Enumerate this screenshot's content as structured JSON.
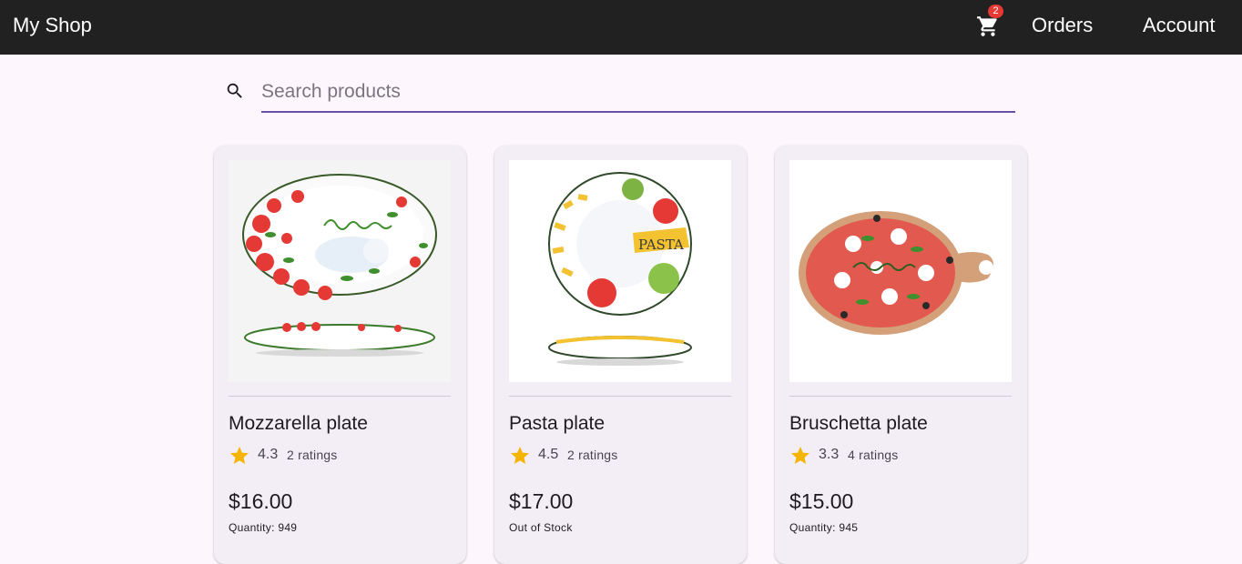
{
  "header": {
    "brand": "My Shop",
    "cart_count": "2",
    "nav": {
      "orders": "Orders",
      "account": "Account"
    }
  },
  "search": {
    "placeholder": "Search products",
    "value": ""
  },
  "products": [
    {
      "name": "Mozzarella plate",
      "rating": "4.3",
      "ratings_count": "2 ratings",
      "price": "$16.00",
      "stock": "Quantity: 949"
    },
    {
      "name": "Pasta plate",
      "rating": "4.5",
      "ratings_count": "2 ratings",
      "price": "$17.00",
      "stock": "Out of Stock"
    },
    {
      "name": "Bruschetta plate",
      "rating": "3.3",
      "ratings_count": "4 ratings",
      "price": "$15.00",
      "stock": "Quantity: 945"
    }
  ],
  "colors": {
    "topbar": "#212121",
    "accent": "#6750a4",
    "badge": "#e53935",
    "star": "#f4b400",
    "card": "#f3eef6"
  },
  "icons": [
    "cart-icon",
    "search-icon",
    "star-icon"
  ]
}
